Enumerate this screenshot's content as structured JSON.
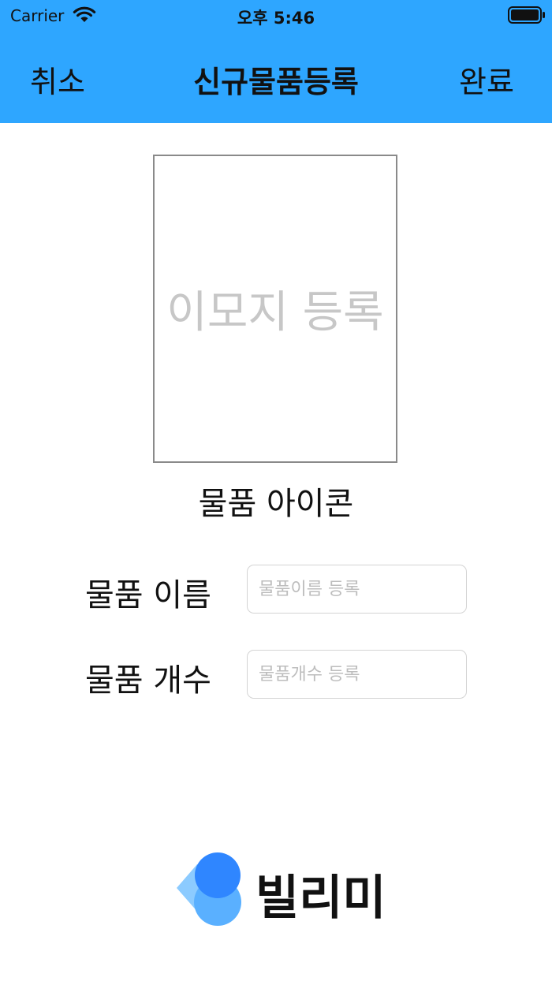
{
  "status_bar": {
    "carrier": "Carrier",
    "time": "오후 5:46"
  },
  "nav": {
    "cancel_label": "취소",
    "title": "신규물품등록",
    "done_label": "완료"
  },
  "emoji_picker": {
    "label": "이모지 등록",
    "caption": "물품 아이콘"
  },
  "form": {
    "name": {
      "label": "물품 이름",
      "placeholder": "물품이름 등록",
      "value": ""
    },
    "count": {
      "label": "물품 개수",
      "placeholder": "물품개수 등록",
      "value": ""
    }
  },
  "logo": {
    "text": "빌리미"
  },
  "colors": {
    "header_bg": "#2EA6FF",
    "logo_dark_blue": "#2F86FF",
    "logo_light_blue": "#5AB0FF",
    "logo_pale_blue": "#8CCBFF"
  },
  "icons": {
    "wifi": "wifi-icon",
    "battery": "battery-icon",
    "logo_mark": "logo-mark-icon"
  }
}
